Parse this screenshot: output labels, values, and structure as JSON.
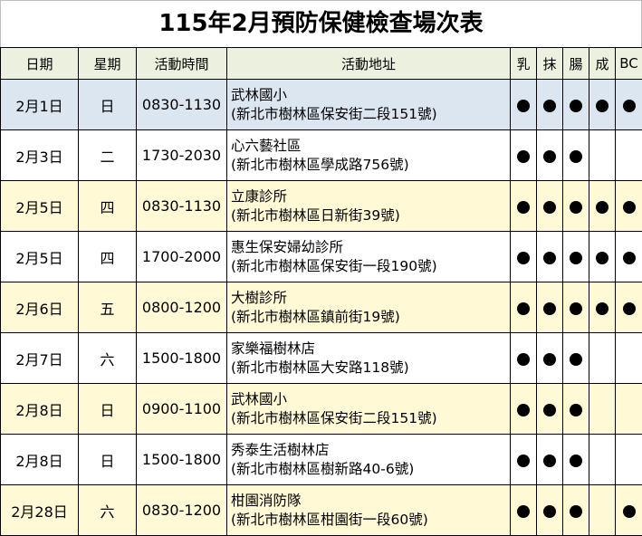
{
  "title": "115年2月預防保健檢查場次表",
  "colors": {
    "header_bg": "#ebf1de",
    "row_blue": "#dce6f1",
    "row_yellow": "#fff9d6",
    "row_white": "#ffffff"
  },
  "columns": [
    "日期",
    "星期",
    "活動時間",
    "活動地址",
    "乳",
    "抹",
    "腸",
    "成",
    "BC"
  ],
  "dot_symbol": "filled-circle",
  "rows": [
    {
      "date": "2月1日",
      "weekday": "日",
      "time": "0830-1130",
      "place": "武林國小",
      "address": "(新北市樹林區保安街二段151號)",
      "checks": [
        true,
        true,
        true,
        true,
        true
      ],
      "bg": "row_blue"
    },
    {
      "date": "2月3日",
      "weekday": "二",
      "time": "1730-2030",
      "place": "心六藝社區",
      "address": "(新北市樹林區學成路756號)",
      "checks": [
        true,
        true,
        true,
        false,
        false
      ],
      "bg": "row_white"
    },
    {
      "date": "2月5日",
      "weekday": "四",
      "time": "0830-1130",
      "place": "立康診所",
      "address": "(新北市樹林區日新街39號)",
      "checks": [
        true,
        true,
        true,
        true,
        true
      ],
      "bg": "row_yellow"
    },
    {
      "date": "2月5日",
      "weekday": "四",
      "time": "1700-2000",
      "place": "惠生保安婦幼診所",
      "address": "(新北市樹林區保安街一段190號)",
      "checks": [
        true,
        true,
        true,
        true,
        true
      ],
      "bg": "row_white"
    },
    {
      "date": "2月6日",
      "weekday": "五",
      "time": "0800-1200",
      "place": "大樹診所",
      "address": "(新北市樹林區鎮前街19號)",
      "checks": [
        true,
        true,
        true,
        true,
        true
      ],
      "bg": "row_yellow"
    },
    {
      "date": "2月7日",
      "weekday": "六",
      "time": "1500-1800",
      "place": "家樂福樹林店",
      "address": "(新北市樹林區大安路118號)",
      "checks": [
        true,
        true,
        true,
        false,
        false
      ],
      "bg": "row_white"
    },
    {
      "date": "2月8日",
      "weekday": "日",
      "time": "0900-1100",
      "place": "武林國小",
      "address": "(新北市樹林區保安街二段151號)",
      "checks": [
        true,
        true,
        true,
        false,
        false
      ],
      "bg": "row_yellow"
    },
    {
      "date": "2月8日",
      "weekday": "日",
      "time": "1500-1800",
      "place": "秀泰生活樹林店",
      "address": "(新北市樹林區樹新路40-6號)",
      "checks": [
        true,
        true,
        true,
        false,
        false
      ],
      "bg": "row_white"
    },
    {
      "date": "2月28日",
      "weekday": "六",
      "time": "0830-1200",
      "place": "柑園消防隊",
      "address": "(新北市樹林區柑園街一段60號)",
      "checks": [
        true,
        true,
        true,
        false,
        true
      ],
      "bg": "row_yellow"
    }
  ]
}
